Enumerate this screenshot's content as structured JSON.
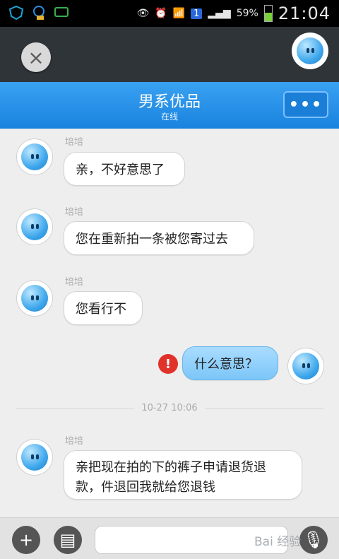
{
  "status_bar": {
    "battery_percent": "59%",
    "time": "21:04",
    "sim_label": "1"
  },
  "header": {
    "title": "男系优品",
    "subtitle": "在线",
    "more_label": "•••"
  },
  "top": {
    "close_label": "×"
  },
  "messages": [
    {
      "sender": "培培",
      "text": "亲，不好意思了"
    },
    {
      "sender": "培培",
      "text": "您在重新拍一条被您寄过去"
    },
    {
      "sender": "培培",
      "text": "您看行不"
    },
    {
      "text": "什么意思？",
      "error_mark": "!"
    },
    {
      "sender": "培培",
      "text": "亲把现在拍的下的裤子申请退货退款，件退回我就给您退钱"
    }
  ],
  "timestamp": "10-27 10:06",
  "input_bar": {
    "add_label": "+",
    "emoji_label": "▤",
    "value": "",
    "voice_label": "🎙"
  },
  "watermark": "Bai 经验",
  "colors": {
    "header_blue": "#2a8fe6",
    "outgoing_bubble": "#8fd0ff",
    "error_red": "#e0322b"
  }
}
